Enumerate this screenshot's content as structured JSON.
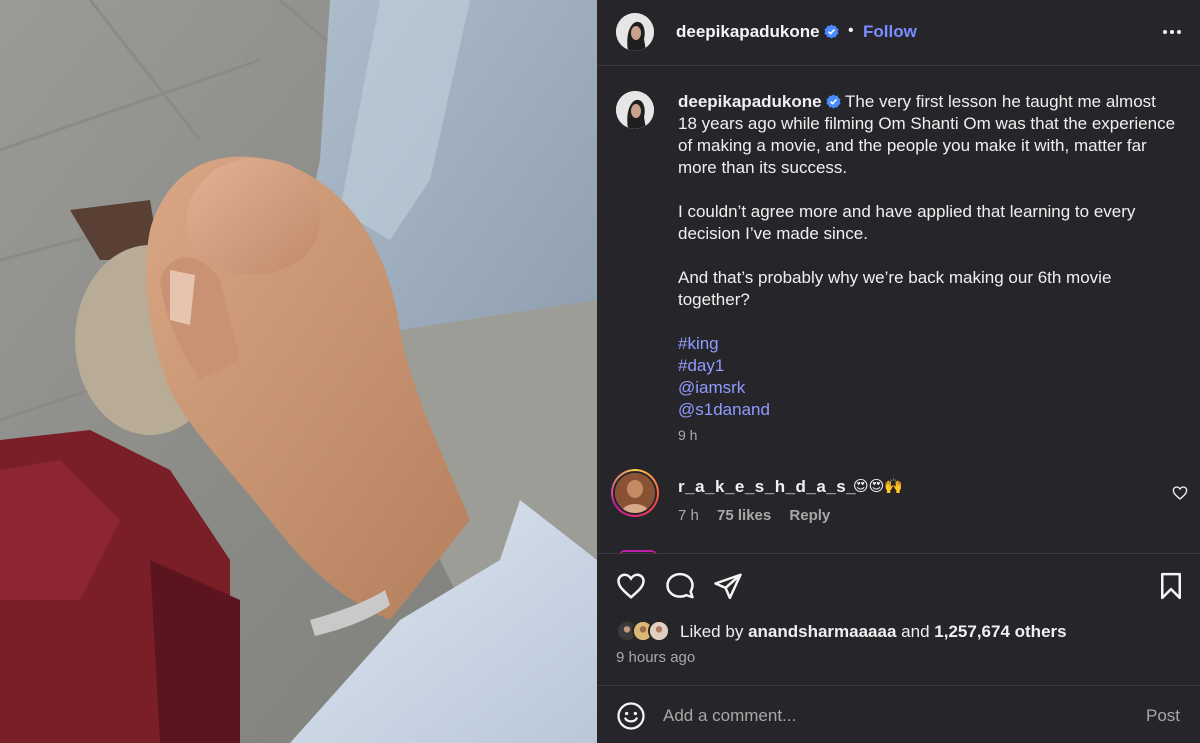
{
  "post": {
    "username": "deepikapadukone",
    "follow_label": "Follow",
    "dot": "•",
    "more_icon": "more-horizontal-icon"
  },
  "caption": {
    "username": "deepikapadukone",
    "para1": "The very first lesson he taught me almost 18 years ago while filming Om Shanti Om was that the experience of making a movie, and the people you make it with, matter far more than its success.",
    "para2": "I couldn’t agree more and have applied that learning to every decision I’ve made since.",
    "para3": "And that’s probably why we’re back making our 6th movie together?",
    "tags": [
      "#king",
      "#day1",
      "@iamsrk",
      "@s1danand"
    ],
    "time": "9 h"
  },
  "comment": {
    "username": "r_a_k_e_s_h_d_a_s_",
    "emojis": "😍😍🙌",
    "time": "7 h",
    "likes": "75 likes",
    "reply_label": "Reply"
  },
  "likes": {
    "prefix": "Liked by",
    "user": "anandsharmaaaaa",
    "middle": "and",
    "count": "1,257,674 others"
  },
  "posted_ago": "9 hours ago",
  "add_comment": {
    "placeholder": "Add a comment...",
    "post_label": "Post"
  },
  "colors": {
    "panel_bg": "#26262a",
    "link": "#7b8cff",
    "hashtag": "#8f9bff",
    "verified": "#4a8cff"
  }
}
